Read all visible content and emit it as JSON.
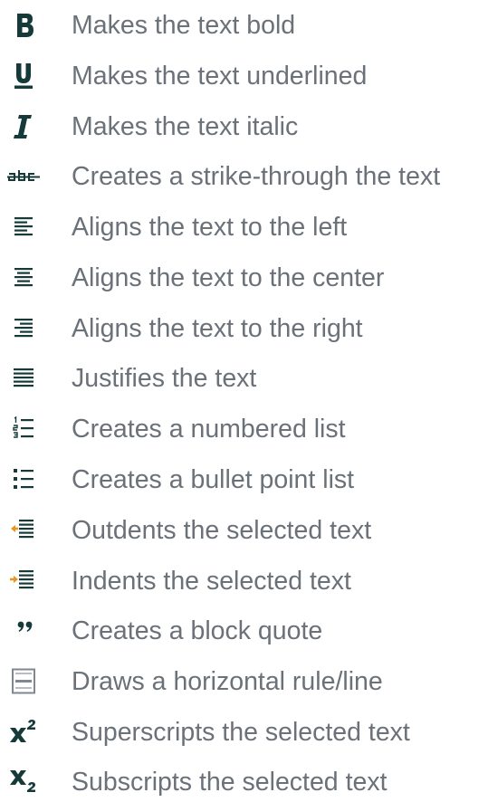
{
  "accent_color": "#163a3a",
  "arrow_color": "#e8951a",
  "text_color": "#6b7178",
  "items": [
    {
      "icon": "bold-icon",
      "label": "Makes the text bold"
    },
    {
      "icon": "underline-icon",
      "label": "Makes the text underlined"
    },
    {
      "icon": "italic-icon",
      "label": "Makes the text italic"
    },
    {
      "icon": "strikethrough-icon",
      "label": "Creates a strike-through the text"
    },
    {
      "icon": "align-left-icon",
      "label": "Aligns the text to the left"
    },
    {
      "icon": "align-center-icon",
      "label": "Aligns the text to the center"
    },
    {
      "icon": "align-right-icon",
      "label": "Aligns the text to the right"
    },
    {
      "icon": "justify-icon",
      "label": "Justifies the text"
    },
    {
      "icon": "numbered-list-icon",
      "label": "Creates a numbered list"
    },
    {
      "icon": "bullet-list-icon",
      "label": "Creates a bullet point list"
    },
    {
      "icon": "outdent-icon",
      "label": "Outdents the selected text"
    },
    {
      "icon": "indent-icon",
      "label": "Indents the selected text"
    },
    {
      "icon": "blockquote-icon",
      "label": "Creates a block quote"
    },
    {
      "icon": "horizontal-rule-icon",
      "label": "Draws a horizontal rule/line"
    },
    {
      "icon": "superscript-icon",
      "label": "Superscripts the selected text"
    },
    {
      "icon": "subscript-icon",
      "label": "Subscripts the selected text"
    }
  ]
}
